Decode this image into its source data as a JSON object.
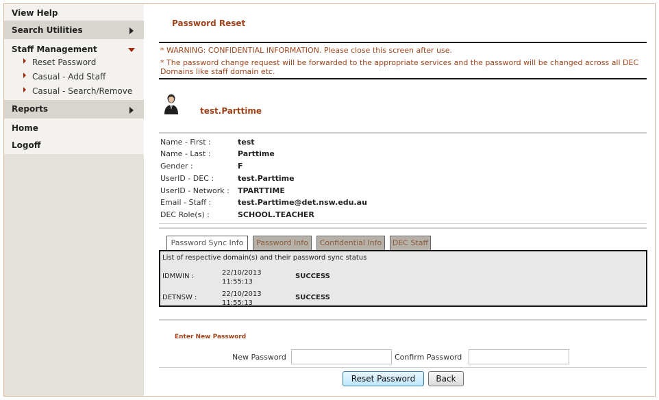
{
  "sidebar": {
    "view_help": "View Help",
    "search_utilities": "Search Utilities",
    "staff_management": "Staff Management",
    "staff_items": [
      "Reset Password",
      "Casual - Add Staff",
      "Casual - Search/Remove"
    ],
    "reports": "Reports",
    "home": "Home",
    "logoff": "Logoff"
  },
  "main": {
    "title": "Password Reset",
    "warning_1": "* WARNING: CONFIDENTIAL INFORMATION. Please close this screen after use.",
    "warning_2": "* The password change request will be forwarded to the appropriate services and the password will be changed across all DEC Domains like staff domain etc.",
    "username": "test.Parttime",
    "details": [
      {
        "label": "Name - First :",
        "value": "test"
      },
      {
        "label": "Name - Last :",
        "value": "Parttime"
      },
      {
        "label": "Gender :",
        "value": "F"
      },
      {
        "label": "UserID - DEC :",
        "value": "test.Parttime"
      },
      {
        "label": "UserID - Network :",
        "value": "TPARTTIME"
      },
      {
        "label": "Email - Staff :",
        "value": "test.Parttime@det.nsw.edu.au"
      },
      {
        "label": "DEC Role(s) :",
        "value": "SCHOOL.TEACHER"
      }
    ],
    "tabs": [
      "Password Sync Info",
      "Password Info",
      "Confidential Info",
      "DEC Staff"
    ],
    "panel_title": "List of respective domain(s) and their password sync status",
    "sync": [
      {
        "domain": "IDMWIN :",
        "time": "22/10/2013\n11:55:13",
        "status": "SUCCESS"
      },
      {
        "domain": "DETNSW :",
        "time": "22/10/2013\n11:55:13",
        "status": "SUCCESS"
      }
    ],
    "enter_title": "Enter New Password",
    "new_password_label": "New Password",
    "new_password_value": "",
    "confirm_password_label": "Confirm Password",
    "confirm_password_value": "",
    "reset_button": "Reset Password",
    "back_button": "Back"
  },
  "colors": {
    "accent": "#a0431a",
    "sidebar_bg": "#e4e1da"
  }
}
